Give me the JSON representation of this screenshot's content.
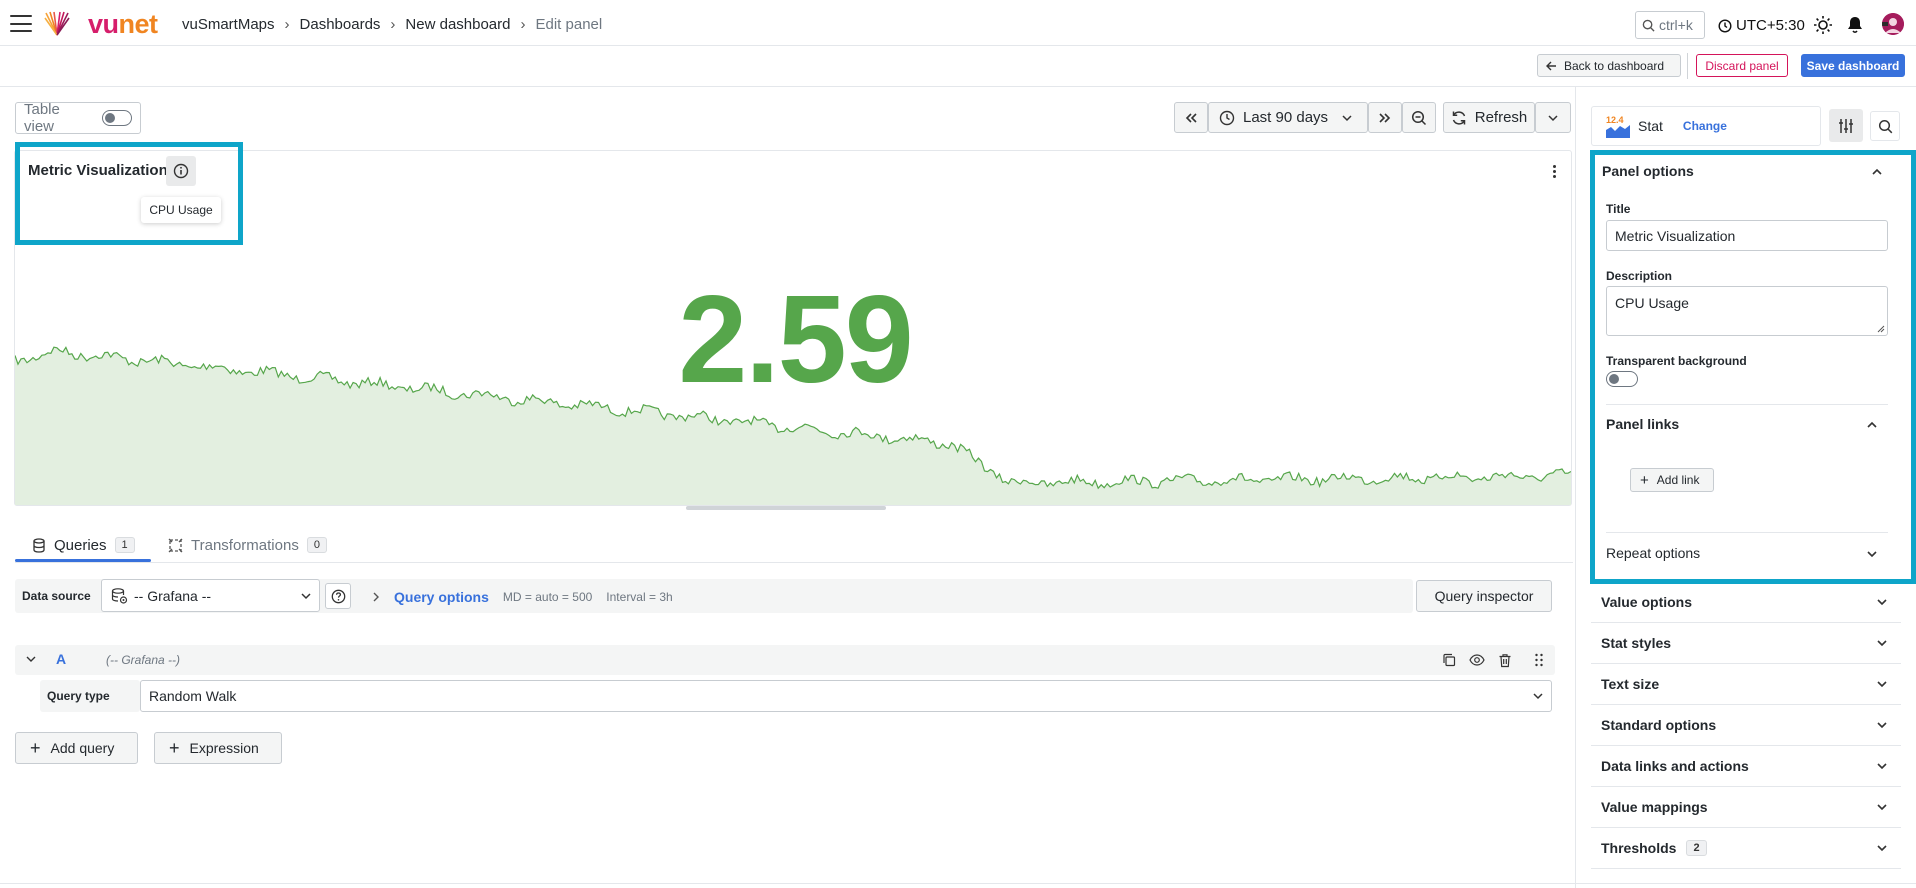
{
  "brand": {
    "logo_v": "vu",
    "logo_net": "net"
  },
  "breadcrumbs": [
    "vuSmartMaps",
    "Dashboards",
    "New dashboard",
    "Edit panel"
  ],
  "header": {
    "search_placeholder": "ctrl+k",
    "timezone": "UTC+5:30"
  },
  "actions": {
    "back": "Back to dashboard",
    "discard": "Discard panel",
    "save": "Save dashboard"
  },
  "toolbar": {
    "table_view": "Table view",
    "time_range": "Last 90 days",
    "refresh": "Refresh"
  },
  "panel": {
    "title": "Metric Visualization",
    "tooltip": "CPU Usage",
    "value": "2.59",
    "value_color": "#56a64b"
  },
  "query_tabs": [
    {
      "label": "Queries",
      "count": "1"
    },
    {
      "label": "Transformations",
      "count": "0"
    }
  ],
  "datasource": {
    "label": "Data source",
    "value": "-- Grafana --",
    "query_options": "Query options",
    "md": "MD = auto = 500",
    "interval": "Interval = 3h",
    "inspector": "Query inspector"
  },
  "query_a": {
    "ref": "A",
    "ds": "(-- Grafana --)",
    "type_label": "Query type",
    "type_value": "Random Walk"
  },
  "query_actions": {
    "add_query": "Add query",
    "expression": "Expression"
  },
  "viz": {
    "icon_text": "12.4",
    "name": "Stat",
    "change": "Change"
  },
  "panel_options": {
    "section": "Panel options",
    "title_label": "Title",
    "title_value": "Metric Visualization",
    "desc_label": "Description",
    "desc_value": "CPU Usage",
    "transparent_label": "Transparent background",
    "links_section": "Panel links",
    "add_link": "Add link",
    "repeat_section": "Repeat options"
  },
  "option_sections": [
    {
      "label": "Value options"
    },
    {
      "label": "Stat styles"
    },
    {
      "label": "Text size"
    },
    {
      "label": "Standard options"
    },
    {
      "label": "Data links and actions"
    },
    {
      "label": "Value mappings"
    },
    {
      "label": "Thresholds",
      "count": "2"
    }
  ],
  "colors": {
    "accent": "#3871dc",
    "highlight": "#0ea5c9",
    "danger": "#d4145a",
    "series": "#56a64b"
  }
}
